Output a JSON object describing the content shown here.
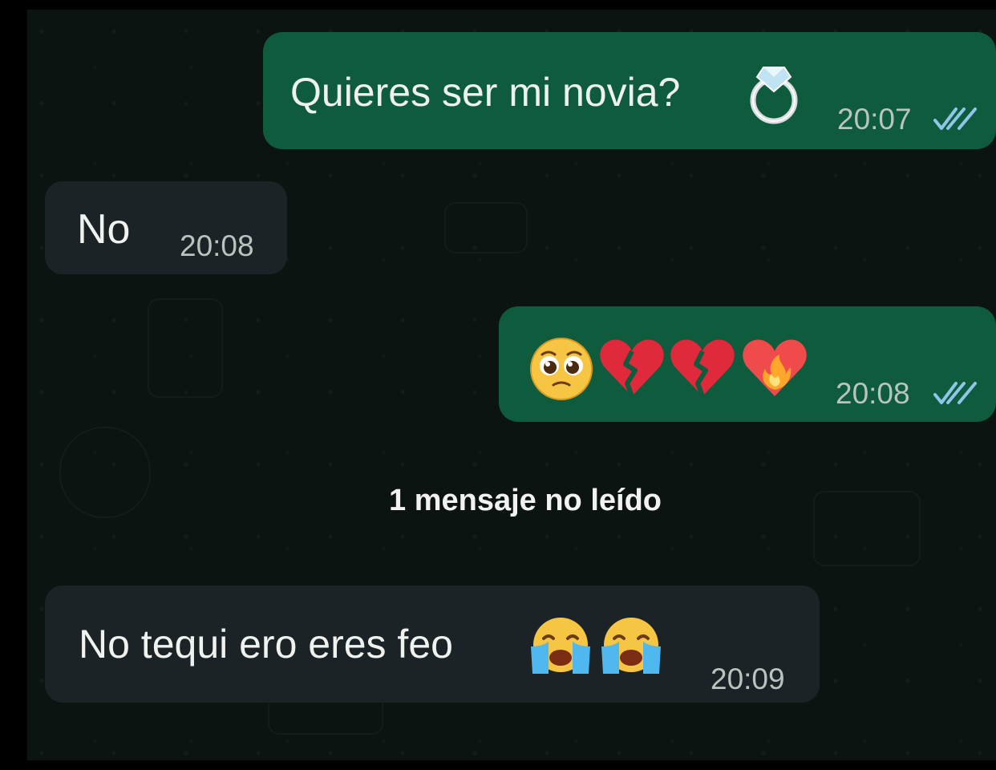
{
  "chat": {
    "messages": [
      {
        "direction": "out",
        "text": "Quieres ser mi novia?",
        "emoji_names": [
          "ring"
        ],
        "time": "20:07",
        "status": "read"
      },
      {
        "direction": "in",
        "text": "No",
        "time": "20:08"
      },
      {
        "direction": "out",
        "text": "",
        "emoji_names": [
          "pleading-face",
          "broken-heart",
          "broken-heart",
          "heart-on-fire"
        ],
        "time": "20:08",
        "status": "read"
      },
      {
        "direction": "in",
        "text": "No tequi ero eres feo",
        "emoji_names": [
          "loudly-crying-face",
          "loudly-crying-face"
        ],
        "time": "20:09"
      }
    ],
    "unread_divider": "1 mensaje no leído"
  },
  "colors": {
    "background": "#0c1412",
    "outgoing_bubble": "#0f5b3d",
    "incoming_bubble": "#1c2327",
    "read_ticks": "#8fc6e8"
  }
}
